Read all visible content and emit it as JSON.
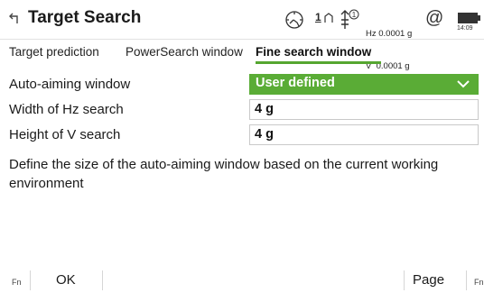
{
  "header": {
    "title": "Target Search",
    "back_icon": "back-arrow-icon",
    "status": {
      "target_icon": "target-lock-icon",
      "face": "1",
      "prism_icon": "prism-icon",
      "prism_number": "1",
      "hz": "Hz 0.0001 g",
      "v": "V  0.0001 g",
      "at_symbol": "@",
      "battery_icon": "battery-icon",
      "time": "14:09"
    }
  },
  "tabs": [
    {
      "label": "Target prediction",
      "active": false
    },
    {
      "label": "PowerSearch window",
      "active": false
    },
    {
      "label": "Fine search window",
      "active": true
    }
  ],
  "form": {
    "auto_aiming": {
      "label": "Auto-aiming window",
      "value": "User defined"
    },
    "width_hz": {
      "label": "Width of Hz search",
      "value": "4 g"
    },
    "height_v": {
      "label": "Height of V search",
      "value": "4 g"
    }
  },
  "description": "Define the size of the auto-aiming window based on the current working environment",
  "footer": {
    "fn_left": "Fn",
    "ok_label": "OK",
    "page_label": "Page",
    "fn_right": "Fn"
  },
  "colors": {
    "accent": "#5aac36",
    "underline": "#55a630"
  }
}
